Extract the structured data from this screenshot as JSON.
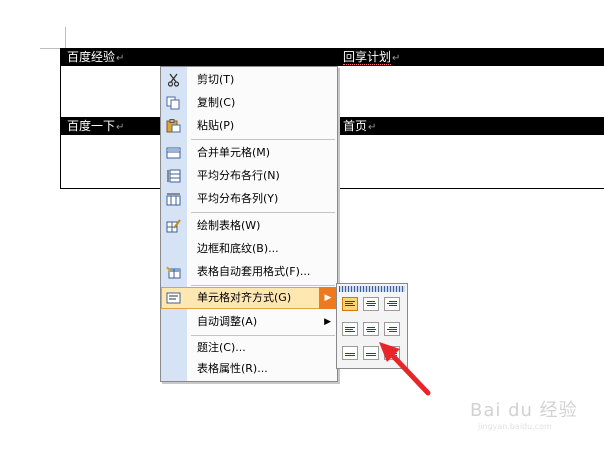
{
  "table": {
    "row1": {
      "cell_a": "百度经验",
      "cell_b": "回享计划"
    },
    "row2": {
      "cell_a": "百度一下",
      "cell_b": "首页"
    },
    "cell_end_mark": "↵"
  },
  "context_menu": {
    "items": [
      {
        "label": "剪切(T)",
        "icon": "scissors-icon"
      },
      {
        "label": "复制(C)",
        "icon": "copy-icon"
      },
      {
        "label": "粘贴(P)",
        "icon": "paste-icon"
      },
      {
        "label": "合并单元格(M)",
        "icon": "merge-cells-icon"
      },
      {
        "label": "平均分布各行(N)",
        "icon": "distribute-rows-icon"
      },
      {
        "label": "平均分布各列(Y)",
        "icon": "distribute-columns-icon"
      },
      {
        "label": "绘制表格(W)",
        "icon": "draw-table-icon"
      },
      {
        "label": "边框和底纹(B)...",
        "icon": ""
      },
      {
        "label": "表格自动套用格式(F)...",
        "icon": "autoformat-icon"
      },
      {
        "label": "单元格对齐方式(G)",
        "icon": "cell-alignment-icon",
        "has_submenu": true,
        "highlighted": true
      },
      {
        "label": "自动调整(A)",
        "icon": "",
        "has_submenu": true
      },
      {
        "label": "题注(C)...",
        "icon": ""
      },
      {
        "label": "表格属性(R)...",
        "icon": ""
      }
    ],
    "submenu_arrow": "▶"
  },
  "alignment_submenu": {
    "selected": "top-left",
    "options": [
      "top-left",
      "top-center",
      "top-right",
      "middle-left",
      "middle-center",
      "middle-right",
      "bottom-left",
      "bottom-center",
      "bottom-right"
    ]
  },
  "colors": {
    "highlight": "#ffe7b2",
    "highlight_arrow": "#ee7a1d",
    "gutter": "#d6e3f5",
    "annotation_arrow": "#e8262a"
  },
  "watermark": {
    "brand": "Bai du 经验",
    "url": "jingyan.baidu.com"
  }
}
